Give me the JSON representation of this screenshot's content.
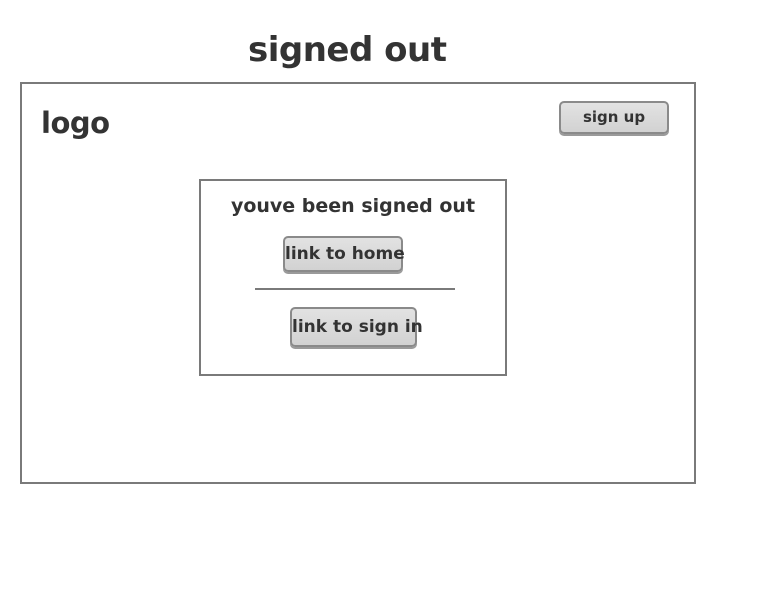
{
  "page": {
    "title": "signed out"
  },
  "header": {
    "logo_text": "logo",
    "signup_label": "sign up"
  },
  "dialog": {
    "message": "youve been signed out",
    "home_link_label": "link to home",
    "signin_link_label": "link to sign in"
  }
}
